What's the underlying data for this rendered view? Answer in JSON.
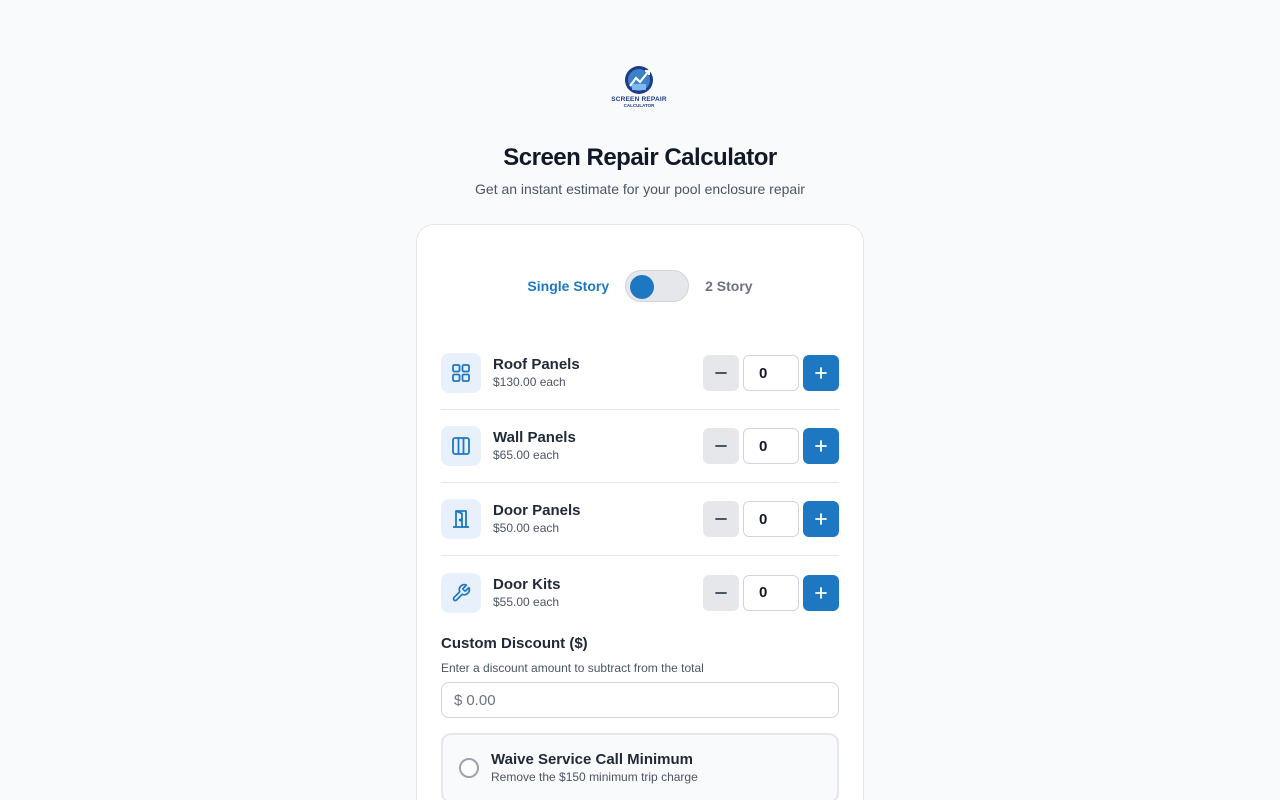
{
  "brand": {
    "logo_line1": "SCREEN REPAIR",
    "logo_line2": "CALCULATOR",
    "accent": "#1d78c1"
  },
  "header": {
    "title": "Screen Repair Calculator",
    "subtitle": "Get an instant estimate for your pool enclosure repair"
  },
  "story": {
    "option_single": "Single Story",
    "option_two": "2 Story",
    "selected": "Single Story"
  },
  "items": [
    {
      "name": "Roof Panels",
      "price": "$130.00 each",
      "quantity": "0",
      "icon": "grid-icon"
    },
    {
      "name": "Wall Panels",
      "price": "$65.00 each",
      "quantity": "0",
      "icon": "columns-icon"
    },
    {
      "name": "Door Panels",
      "price": "$50.00 each",
      "quantity": "0",
      "icon": "door-icon"
    },
    {
      "name": "Door Kits",
      "price": "$55.00 each",
      "quantity": "0",
      "icon": "wrench-icon"
    }
  ],
  "discount": {
    "label": "Custom Discount ($)",
    "help": "Enter a discount amount to subtract from the total",
    "currency": "$",
    "placeholder": "0.00",
    "value": ""
  },
  "waive": {
    "title": "Waive Service Call Minimum",
    "description": "Remove the $150 minimum trip charge",
    "checked": false
  }
}
